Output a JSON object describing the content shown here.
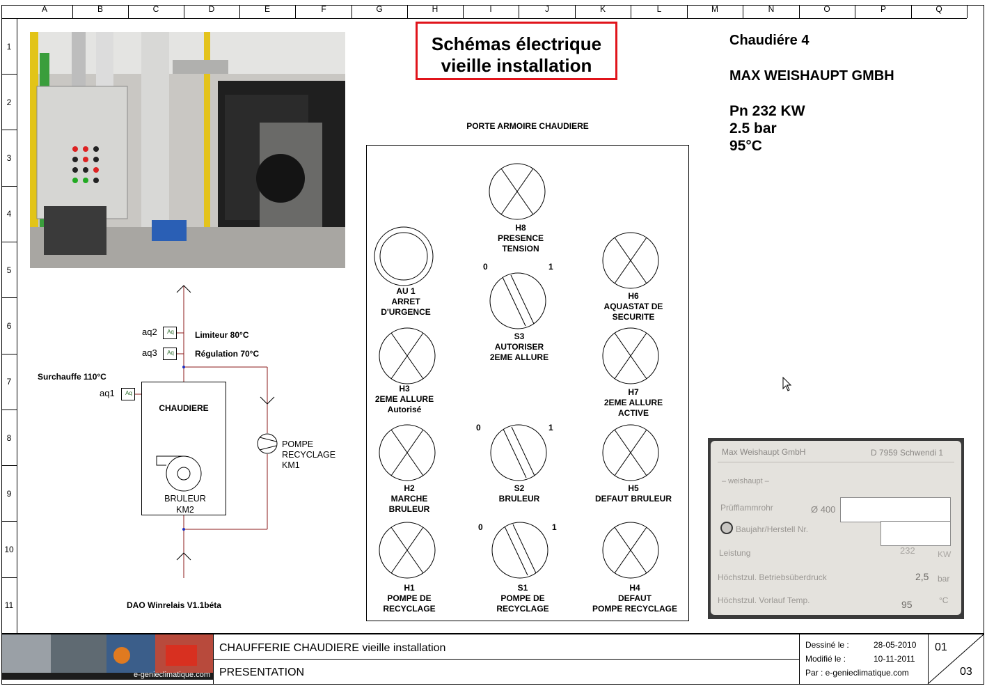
{
  "grid": {
    "columns": [
      "A",
      "B",
      "C",
      "D",
      "E",
      "F",
      "G",
      "H",
      "I",
      "J",
      "K",
      "L",
      "M",
      "N",
      "O",
      "P",
      "Q"
    ],
    "rows": [
      "1",
      "2",
      "3",
      "4",
      "5",
      "6",
      "7",
      "8",
      "9",
      "10",
      "11"
    ]
  },
  "title_box": {
    "line1": "Schémas électrique",
    "line2": "vieille installation"
  },
  "boiler_info": {
    "name": "Chaudiére 4",
    "maker": "MAX WEISHAUPT GMBH",
    "power": "Pn 232 KW",
    "pressure": "2.5 bar",
    "temperature": "95°C"
  },
  "cabinet": {
    "title": "PORTE ARMOIRE CHAUDIERE",
    "h8": [
      "H8",
      "PRESENCE",
      "TENSION"
    ],
    "au1": [
      "AU 1",
      "ARRET",
      "D'URGENCE"
    ],
    "h6": [
      "H6",
      "AQUASTAT DE",
      "SECURITE"
    ],
    "s3": [
      "S3",
      "AUTORISER",
      "2EME ALLURE"
    ],
    "h3": [
      "H3",
      "2EME ALLURE",
      "Autorisé"
    ],
    "h7": [
      "H7",
      "2EME ALLURE",
      "ACTIVE"
    ],
    "h2": [
      "H2",
      "MARCHE",
      "BRULEUR"
    ],
    "s2": [
      "S2",
      "BRULEUR"
    ],
    "h5": [
      "H5",
      "DEFAUT BRULEUR"
    ],
    "h1": [
      "H1",
      "POMPE DE",
      "RECYCLAGE"
    ],
    "s1": [
      "S1",
      "POMPE DE",
      "RECYCLAGE"
    ],
    "h4": [
      "H4",
      "DEFAUT",
      "POMPE RECYCLAGE"
    ],
    "switch_zero": "0",
    "switch_one": "1"
  },
  "schematic": {
    "aq2": "aq2",
    "aq3": "aq3",
    "aq1": "aq1",
    "aq_box": "Aq",
    "limiteur": "Limiteur 80°C",
    "regulation": "Régulation 70°C",
    "surchauffe": "Surchauffe 110°C",
    "chaudiere": "CHAUDIERE",
    "bruleur": "BRULEUR",
    "km2": "KM2",
    "pompe": "POMPE",
    "recyclage": "RECYCLAGE",
    "km1": "KM1"
  },
  "software": "DAO Winrelais V1.1béta",
  "nameplate": {
    "maker": "Max Weishaupt GmbH",
    "address": "D 7959 Schwendi 1",
    "brand": "– weishaupt –",
    "row1_label": "Prüfflammrohr",
    "row1_value": "Ø 400",
    "row2_label": "Baujahr/Herstell Nr.",
    "row3_label": "Leistung",
    "row3_value": "232",
    "row3_unit": "KW",
    "row4_label": "Höchstzul. Betriebsüberdruck",
    "row4_value": "2,5",
    "row4_unit": "bar",
    "row5_label": "Höchstzul. Vorlauf Temp.",
    "row5_value": "95",
    "row5_unit": "°C"
  },
  "footer": {
    "logo_text": "e-genieclimatique.com",
    "line1_a": "CHAUFFERIE CHAUDIERE",
    "line1_b": " vieille installation",
    "line2": "PRESENTATION",
    "drawn_label": "Dessiné le :",
    "drawn_date": "28-05-2010",
    "modified_label": "Modifié le :",
    "modified_date": "10-11-2011",
    "by": "Par : e-genieclimatique.com",
    "sheet": "01",
    "total": "03"
  }
}
